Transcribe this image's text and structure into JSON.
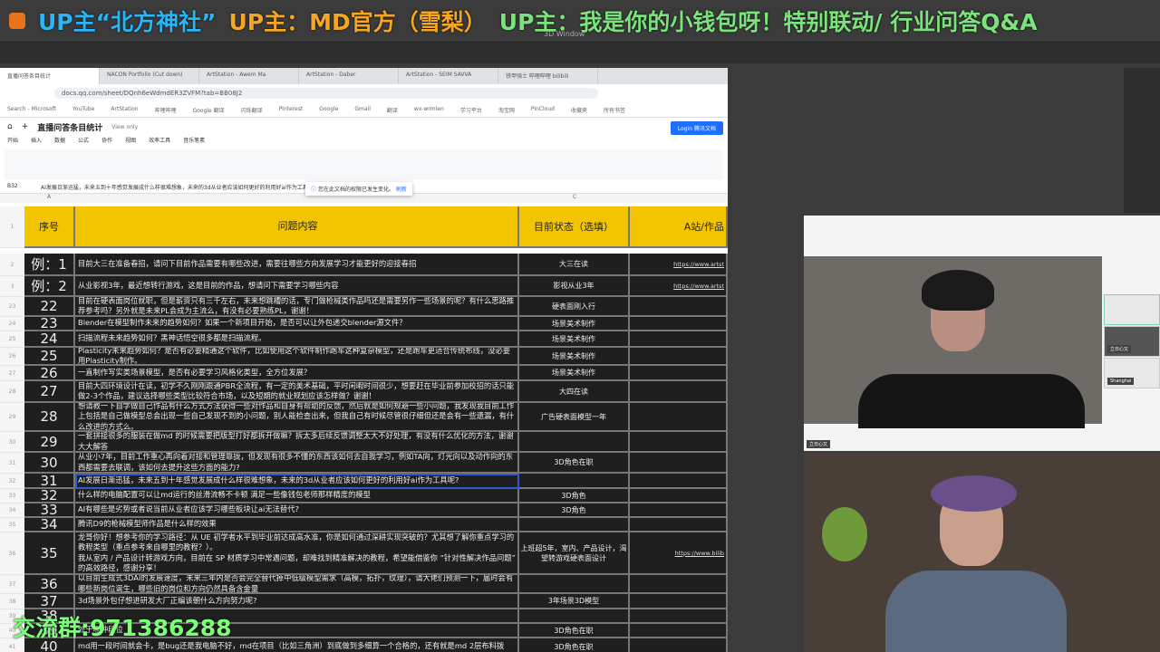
{
  "banner": {
    "part1": "UP主“北方神社”",
    "part2": "UP主：MD官方（雪梨）",
    "part3": "UP主：我是你的小钱包呀！特别联动/ 行业问答Q&A"
  },
  "app": {
    "window_title": "3D Window"
  },
  "browser": {
    "tabs": [
      "直播问答条目统计",
      "NACON Portfolio (Cut down)",
      "ArtStation - Awem Ma",
      "ArtStation - Daber",
      "ArtStation - SEIM SAVVA",
      "铁甲骑士 哔哩哔哩 bilibili"
    ],
    "url": "docs.qq.com/sheet/DQnh6eWdmdER3ZVFM?tab=BB08J2",
    "bookmarks": [
      "Search - Microsoft",
      "YouTube",
      "ArtStation",
      "哔哩哔哩",
      "Google 翻译",
      "闪烁翻译",
      "Pinterest",
      "Google",
      "Gmail",
      "翻译",
      "wx-wrmlen",
      "学习平台",
      "淘宝网",
      "PinCloud",
      "收藏夹",
      "所有书签"
    ]
  },
  "doc": {
    "title": "直播问答条目统计",
    "view_only": "View only",
    "login": "Login 腾讯文档",
    "menu": [
      "开始",
      "插入",
      "数据",
      "公式",
      "协作",
      "视图",
      "效率工具",
      "音乐笔素"
    ],
    "cell_ref": "B32",
    "formula": "AI发展日渐迅猛，未来五到十年感觉发展成什么样很难想象，未来的3d从业者应该如何更好的利用好ai作为工具呢?",
    "notice": "您在此文档的权限已发生变化。",
    "notice_action": "刷新",
    "col_a": "A",
    "col_c": "C"
  },
  "table": {
    "headers": [
      "序号",
      "问题内容",
      "目前状态（选填）",
      "A站/作品"
    ],
    "rows": [
      {
        "rn": "2",
        "seq": "例：1",
        "q": "目前大三在准备春招，请问下目前作品需要有哪些改进，需要往哪些方向发展学习才能更好的迎接春招",
        "status": "大三在读",
        "link": "https://www.artst"
      },
      {
        "rn": "3",
        "seq": "例：2",
        "q": "从业影视3年，最近想转行游戏，这是目前的作品，想请问下需要学习哪些内容",
        "status": "影视从业3年",
        "link": "https://www.artst"
      },
      {
        "rn": "23",
        "seq": "22",
        "q": "目前在硬表面岗位就职，但是薪资只有三千左右，未来想跳槽的话，专门做枪械类作品吗还是需要另作一些场景的呢？有什么思路推荐参考吗？另外就是未来PL会成为主流么，有没有必要熟练PL，谢谢！",
        "status": "硬表面刚入行",
        "link": ""
      },
      {
        "rn": "24",
        "seq": "23",
        "q": "Blender在模型制作未来的趋势如何？如果一个新项目开始，是否可以让外包递交blender源文件？",
        "status": "场景美术制作",
        "link": ""
      },
      {
        "rn": "25",
        "seq": "24",
        "q": "扫描流程未来趋势如何？黑神话悟空很多都是扫描流程。",
        "status": "场景美术制作",
        "link": ""
      },
      {
        "rn": "26",
        "seq": "25",
        "q": "Plasticity未来趋势如何？是否有必要精通这个软件，比如使用这个软件制作跑车这种复杂模型，还是跑车更适合传统布线，没必要用Plasticity制作。",
        "status": "场景美术制作",
        "link": ""
      },
      {
        "rn": "27",
        "seq": "26",
        "q": "一直制作写实类场景模型，是否有必要学习风格化类型，全方位发展？",
        "status": "场景美术制作",
        "link": ""
      },
      {
        "rn": "28",
        "seq": "27",
        "q": "目前大四环境设计在读，初学不久刚刚跟通PBR全流程，有一定的美术基础，平时闲暇时间很少，想要赶在毕业前参加校招的话只能做2-3个作品，建议选择哪些类型比较符合市场，以及短期的就业规划应该怎样做？谢谢！",
        "status": "大四在读",
        "link": ""
      },
      {
        "rn": "29",
        "seq": "28",
        "q": "想请教一下自学做自己作品有什么方式方法获得一些对作品和自身有帮助的反馈，然后就是如何规避一些小问题，我发现我目前工作上包括是自己做模型总会出现一些自己发现不到的小问题，别人能检查出来，但我自己有时候尽管很仔细但还是会有一些遗漏，有什么改进的方式么。",
        "status": "广告硬表面模型一年",
        "link": ""
      },
      {
        "rn": "30",
        "seq": "29",
        "q": "一套拼接很多的服装在做md 的时候需要把版型打好都拆开做嘛？拆太多后续反馈调整太大不好处理，有没有什么优化的方法，谢谢大大解答",
        "status": "",
        "link": ""
      },
      {
        "rn": "31",
        "seq": "30",
        "q": "从业小7年，目前工作重心再向着对接和管理靠拢，但发现有很多不懂的东西该如何去自我学习，例如TA向，灯光向以及动作向的东西都需要去联调，该如何去提升这些方面的能力?",
        "status": "3D角色在职",
        "link": ""
      },
      {
        "rn": "32",
        "seq": "31",
        "q": "AI发展日渐迅猛，未来五到十年感觉发展成什么样很难想象，未来的3d从业者应该如何更好的利用好ai作为工具呢?",
        "status": "",
        "link": ""
      },
      {
        "rn": "33",
        "seq": "32",
        "q": "什么样的电脑配置可以让md运行的丝滑流畅不卡顿 满足一些像钱包老师那样精度的模型",
        "status": "3D角色",
        "link": ""
      },
      {
        "rn": "34",
        "seq": "33",
        "q": "AI有哪些是劣势或者说当前从业者应该学习哪些板块让ai无法替代?",
        "status": "3D角色",
        "link": ""
      },
      {
        "rn": "35",
        "seq": "34",
        "q": "腾讯D9的枪械模型师作品是什么样的效果",
        "status": "",
        "link": ""
      },
      {
        "rn": "36",
        "seq": "35",
        "q": "龙哥你好！想参考你的学习路径：从 UE 初学者水平到毕业前达成高水准，你是如何通过深耕实现突破的？尤其想了解你重点学习的教程类型（重点参考来自哪里的教程？）。\n我从室内 / 产品设计转游戏方向，目前在 SP 材质学习中常遇问题，却难找到精准解决的教程，希望能借鉴你 “针对性解决作品问题” 的高效路径，感谢分享！",
        "status": "上班超5年，室内、产品设计，渴望转游戏硬表面设计",
        "link": "https://www.bilib"
      },
      {
        "rn": "37",
        "seq": "36",
        "q": "以目前生成式3DAI的发展速度，未来三年内是否会完全替代掉中低级模型需求（高模，拓扑，纹理），请大佬们预测一下，届时会有哪些新岗位诞生，哪些旧的岗位和方向仍然具备含金量",
        "status": "",
        "link": ""
      },
      {
        "rn": "38",
        "seq": "37",
        "q": "3d场景外包仔想进研发大厂正编该朝什么方向努力呢?",
        "status": "3年场景3D模型",
        "link": ""
      },
      {
        "rn": "39",
        "seq": "38",
        "q": "",
        "status": "",
        "link": ""
      },
      {
        "rn": "40",
        "seq": "39",
        "q": "处于哪种段位",
        "status": "3D角色在职",
        "link": ""
      },
      {
        "rn": "41",
        "seq": "40",
        "q": "md用一段时间就会卡，是bug还是我电脑不好，md在项目（比如三角洲）到底做到多细算一个合格的，还有就是md 2层布料拨",
        "status": "3D角色在职",
        "link": ""
      }
    ]
  },
  "call": {
    "main_name": "立日心又",
    "participants": [
      "",
      "立日心又",
      "Shanghai"
    ]
  },
  "watermark": "交流群:971386288"
}
